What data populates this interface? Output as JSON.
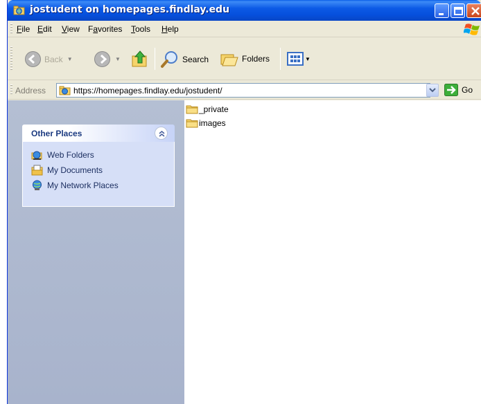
{
  "window": {
    "title": "jostudent on homepages.findlay.edu"
  },
  "menu": [
    {
      "label_before": "",
      "mnemonic": "F",
      "label_after": "ile"
    },
    {
      "label_before": "",
      "mnemonic": "E",
      "label_after": "dit"
    },
    {
      "label_before": "",
      "mnemonic": "V",
      "label_after": "iew"
    },
    {
      "label_before": "F",
      "mnemonic": "a",
      "label_after": "vorites"
    },
    {
      "label_before": "",
      "mnemonic": "T",
      "label_after": "ools"
    },
    {
      "label_before": "",
      "mnemonic": "H",
      "label_after": "elp"
    }
  ],
  "toolbar": {
    "back_label": "Back",
    "search_label": "Search",
    "folders_label": "Folders"
  },
  "address": {
    "label": "Address",
    "value": "https://homepages.findlay.edu/jostudent/",
    "go_label": "Go"
  },
  "left_panel": {
    "title": "Other Places",
    "links": [
      {
        "label": "Web Folders",
        "icon": "web-folders-icon"
      },
      {
        "label": "My Documents",
        "icon": "my-documents-icon"
      },
      {
        "label": "My Network Places",
        "icon": "network-places-icon"
      }
    ]
  },
  "files": [
    {
      "name": "_private",
      "icon": "folder-icon"
    },
    {
      "name": "images",
      "icon": "folder-icon"
    }
  ],
  "colors": {
    "titlebar": "#0650dd",
    "chrome": "#ece9d8",
    "taskpane": "#d6dff7",
    "folder": "#f5d46b"
  }
}
